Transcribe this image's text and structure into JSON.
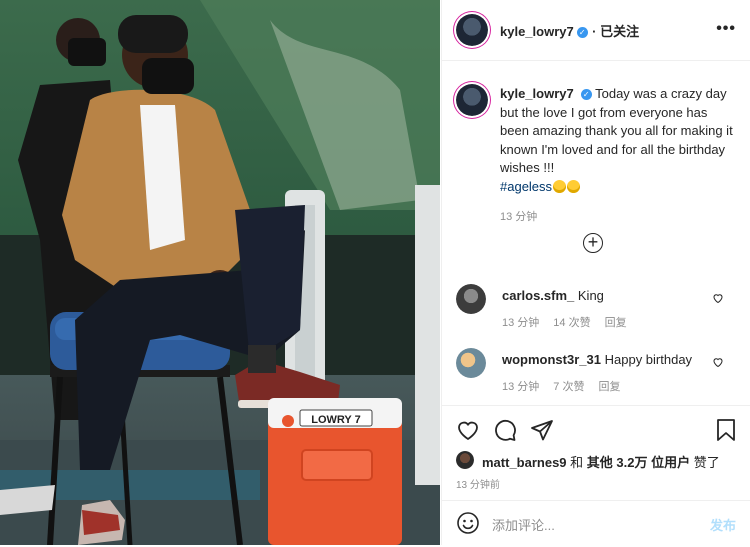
{
  "header": {
    "username": "kyle_lowry7",
    "follow_label": "· 已关注",
    "more_label": "•••"
  },
  "caption": {
    "username": "kyle_lowry7",
    "text": "Today was a crazy day but the love I got from everyone has been amazing thank you all for making it known I'm loved and for all the birthday wishes !!!",
    "hashtag": "#ageless",
    "time": "13 分钟"
  },
  "comments": [
    {
      "username": "carlos.sfm_",
      "text": "King",
      "time": "13 分钟",
      "likes": "14 次赞",
      "reply": "回复"
    },
    {
      "username": "wopmonst3r_31",
      "text": "Happy birthday",
      "time": "13 分钟",
      "likes": "7 次赞",
      "reply": "回复"
    }
  ],
  "likes": {
    "first_user": "matt_barnes9",
    "connector": " 和 ",
    "others": "其他 3.2万 位用户",
    "suffix": " 赞了"
  },
  "post_time": "13 分钟前",
  "add_comment": {
    "placeholder": "添加评论...",
    "post_label": "发布"
  },
  "photo": {
    "cooler_label": "LOWRY 7"
  },
  "colors": {
    "verified": "#3897f0",
    "hashtag": "#00376b",
    "post_button": "#b2dffc",
    "cooler": "#e8552e"
  }
}
